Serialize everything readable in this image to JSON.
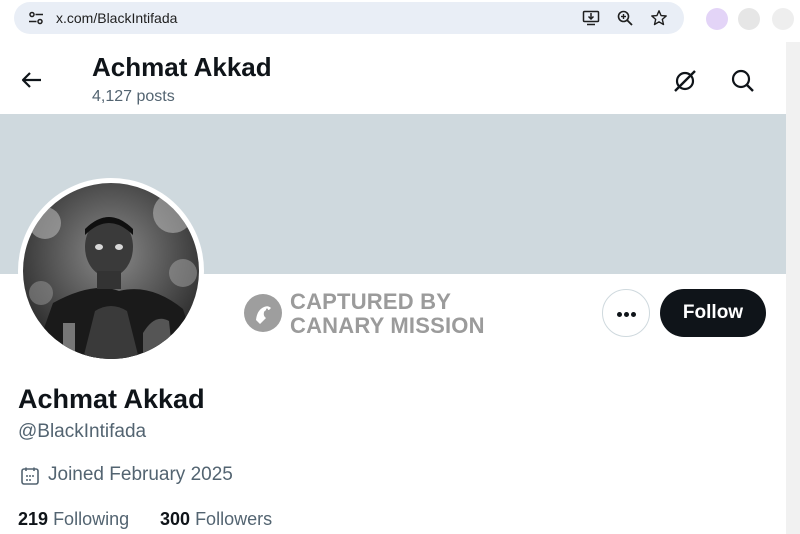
{
  "browser": {
    "url": "x.com/BlackIntifada",
    "icons": [
      "site-settings-icon",
      "install-app-icon",
      "zoom-icon",
      "bookmark-star-icon"
    ]
  },
  "header": {
    "name": "Achmat Akkad",
    "posts": "4,127 posts",
    "icons": [
      "back-arrow-icon",
      "grok-icon",
      "search-icon"
    ]
  },
  "watermark": {
    "line1": "CAPTURED BY",
    "line2": "CANARY MISSION"
  },
  "actions": {
    "follow_label": "Follow",
    "more_icon": "more-options-icon"
  },
  "profile": {
    "display_name": "Achmat Akkad",
    "handle": "@BlackIntifada",
    "joined": "Joined February 2025",
    "following_count": "219",
    "following_label": "Following",
    "followers_count": "300",
    "followers_label": "Followers"
  },
  "colors": {
    "banner": "#cfd9de",
    "follow_bg": "#0f1419",
    "secondary_text": "#536471",
    "url_pill": "#e9eef6"
  }
}
